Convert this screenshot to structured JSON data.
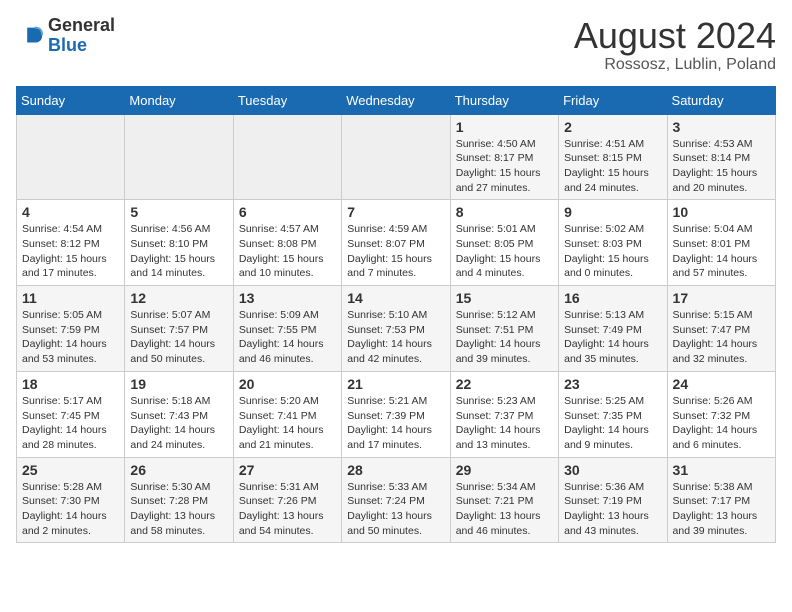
{
  "header": {
    "logo_line1": "General",
    "logo_line2": "Blue",
    "month": "August 2024",
    "location": "Rossosz, Lublin, Poland"
  },
  "days_of_week": [
    "Sunday",
    "Monday",
    "Tuesday",
    "Wednesday",
    "Thursday",
    "Friday",
    "Saturday"
  ],
  "weeks": [
    [
      {
        "day": "",
        "info": ""
      },
      {
        "day": "",
        "info": ""
      },
      {
        "day": "",
        "info": ""
      },
      {
        "day": "",
        "info": ""
      },
      {
        "day": "1",
        "info": "Sunrise: 4:50 AM\nSunset: 8:17 PM\nDaylight: 15 hours\nand 27 minutes."
      },
      {
        "day": "2",
        "info": "Sunrise: 4:51 AM\nSunset: 8:15 PM\nDaylight: 15 hours\nand 24 minutes."
      },
      {
        "day": "3",
        "info": "Sunrise: 4:53 AM\nSunset: 8:14 PM\nDaylight: 15 hours\nand 20 minutes."
      }
    ],
    [
      {
        "day": "4",
        "info": "Sunrise: 4:54 AM\nSunset: 8:12 PM\nDaylight: 15 hours\nand 17 minutes."
      },
      {
        "day": "5",
        "info": "Sunrise: 4:56 AM\nSunset: 8:10 PM\nDaylight: 15 hours\nand 14 minutes."
      },
      {
        "day": "6",
        "info": "Sunrise: 4:57 AM\nSunset: 8:08 PM\nDaylight: 15 hours\nand 10 minutes."
      },
      {
        "day": "7",
        "info": "Sunrise: 4:59 AM\nSunset: 8:07 PM\nDaylight: 15 hours\nand 7 minutes."
      },
      {
        "day": "8",
        "info": "Sunrise: 5:01 AM\nSunset: 8:05 PM\nDaylight: 15 hours\nand 4 minutes."
      },
      {
        "day": "9",
        "info": "Sunrise: 5:02 AM\nSunset: 8:03 PM\nDaylight: 15 hours\nand 0 minutes."
      },
      {
        "day": "10",
        "info": "Sunrise: 5:04 AM\nSunset: 8:01 PM\nDaylight: 14 hours\nand 57 minutes."
      }
    ],
    [
      {
        "day": "11",
        "info": "Sunrise: 5:05 AM\nSunset: 7:59 PM\nDaylight: 14 hours\nand 53 minutes."
      },
      {
        "day": "12",
        "info": "Sunrise: 5:07 AM\nSunset: 7:57 PM\nDaylight: 14 hours\nand 50 minutes."
      },
      {
        "day": "13",
        "info": "Sunrise: 5:09 AM\nSunset: 7:55 PM\nDaylight: 14 hours\nand 46 minutes."
      },
      {
        "day": "14",
        "info": "Sunrise: 5:10 AM\nSunset: 7:53 PM\nDaylight: 14 hours\nand 42 minutes."
      },
      {
        "day": "15",
        "info": "Sunrise: 5:12 AM\nSunset: 7:51 PM\nDaylight: 14 hours\nand 39 minutes."
      },
      {
        "day": "16",
        "info": "Sunrise: 5:13 AM\nSunset: 7:49 PM\nDaylight: 14 hours\nand 35 minutes."
      },
      {
        "day": "17",
        "info": "Sunrise: 5:15 AM\nSunset: 7:47 PM\nDaylight: 14 hours\nand 32 minutes."
      }
    ],
    [
      {
        "day": "18",
        "info": "Sunrise: 5:17 AM\nSunset: 7:45 PM\nDaylight: 14 hours\nand 28 minutes."
      },
      {
        "day": "19",
        "info": "Sunrise: 5:18 AM\nSunset: 7:43 PM\nDaylight: 14 hours\nand 24 minutes."
      },
      {
        "day": "20",
        "info": "Sunrise: 5:20 AM\nSunset: 7:41 PM\nDaylight: 14 hours\nand 21 minutes."
      },
      {
        "day": "21",
        "info": "Sunrise: 5:21 AM\nSunset: 7:39 PM\nDaylight: 14 hours\nand 17 minutes."
      },
      {
        "day": "22",
        "info": "Sunrise: 5:23 AM\nSunset: 7:37 PM\nDaylight: 14 hours\nand 13 minutes."
      },
      {
        "day": "23",
        "info": "Sunrise: 5:25 AM\nSunset: 7:35 PM\nDaylight: 14 hours\nand 9 minutes."
      },
      {
        "day": "24",
        "info": "Sunrise: 5:26 AM\nSunset: 7:32 PM\nDaylight: 14 hours\nand 6 minutes."
      }
    ],
    [
      {
        "day": "25",
        "info": "Sunrise: 5:28 AM\nSunset: 7:30 PM\nDaylight: 14 hours\nand 2 minutes."
      },
      {
        "day": "26",
        "info": "Sunrise: 5:30 AM\nSunset: 7:28 PM\nDaylight: 13 hours\nand 58 minutes."
      },
      {
        "day": "27",
        "info": "Sunrise: 5:31 AM\nSunset: 7:26 PM\nDaylight: 13 hours\nand 54 minutes."
      },
      {
        "day": "28",
        "info": "Sunrise: 5:33 AM\nSunset: 7:24 PM\nDaylight: 13 hours\nand 50 minutes."
      },
      {
        "day": "29",
        "info": "Sunrise: 5:34 AM\nSunset: 7:21 PM\nDaylight: 13 hours\nand 46 minutes."
      },
      {
        "day": "30",
        "info": "Sunrise: 5:36 AM\nSunset: 7:19 PM\nDaylight: 13 hours\nand 43 minutes."
      },
      {
        "day": "31",
        "info": "Sunrise: 5:38 AM\nSunset: 7:17 PM\nDaylight: 13 hours\nand 39 minutes."
      }
    ]
  ]
}
